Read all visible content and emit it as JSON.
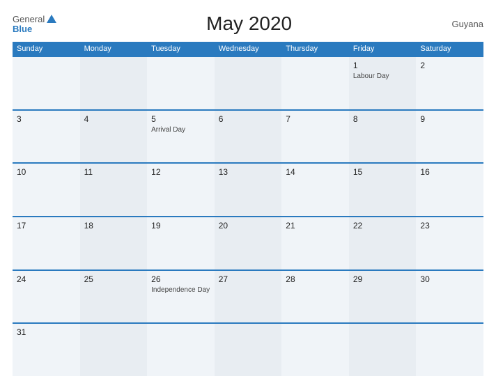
{
  "header": {
    "logo_general": "General",
    "logo_blue": "Blue",
    "title": "May 2020",
    "country": "Guyana"
  },
  "weekdays": [
    "Sunday",
    "Monday",
    "Tuesday",
    "Wednesday",
    "Thursday",
    "Friday",
    "Saturday"
  ],
  "weeks": [
    [
      {
        "day": "",
        "holiday": ""
      },
      {
        "day": "",
        "holiday": ""
      },
      {
        "day": "",
        "holiday": ""
      },
      {
        "day": "",
        "holiday": ""
      },
      {
        "day": "",
        "holiday": ""
      },
      {
        "day": "1",
        "holiday": "Labour Day"
      },
      {
        "day": "2",
        "holiday": ""
      }
    ],
    [
      {
        "day": "3",
        "holiday": ""
      },
      {
        "day": "4",
        "holiday": ""
      },
      {
        "day": "5",
        "holiday": "Arrival Day"
      },
      {
        "day": "6",
        "holiday": ""
      },
      {
        "day": "7",
        "holiday": ""
      },
      {
        "day": "8",
        "holiday": ""
      },
      {
        "day": "9",
        "holiday": ""
      }
    ],
    [
      {
        "day": "10",
        "holiday": ""
      },
      {
        "day": "11",
        "holiday": ""
      },
      {
        "day": "12",
        "holiday": ""
      },
      {
        "day": "13",
        "holiday": ""
      },
      {
        "day": "14",
        "holiday": ""
      },
      {
        "day": "15",
        "holiday": ""
      },
      {
        "day": "16",
        "holiday": ""
      }
    ],
    [
      {
        "day": "17",
        "holiday": ""
      },
      {
        "day": "18",
        "holiday": ""
      },
      {
        "day": "19",
        "holiday": ""
      },
      {
        "day": "20",
        "holiday": ""
      },
      {
        "day": "21",
        "holiday": ""
      },
      {
        "day": "22",
        "holiday": ""
      },
      {
        "day": "23",
        "holiday": ""
      }
    ],
    [
      {
        "day": "24",
        "holiday": ""
      },
      {
        "day": "25",
        "holiday": ""
      },
      {
        "day": "26",
        "holiday": "Independence Day"
      },
      {
        "day": "27",
        "holiday": ""
      },
      {
        "day": "28",
        "holiday": ""
      },
      {
        "day": "29",
        "holiday": ""
      },
      {
        "day": "30",
        "holiday": ""
      }
    ],
    [
      {
        "day": "31",
        "holiday": ""
      },
      {
        "day": "",
        "holiday": ""
      },
      {
        "day": "",
        "holiday": ""
      },
      {
        "day": "",
        "holiday": ""
      },
      {
        "day": "",
        "holiday": ""
      },
      {
        "day": "",
        "holiday": ""
      },
      {
        "day": "",
        "holiday": ""
      }
    ]
  ],
  "colors": {
    "accent": "#2a7abf",
    "cell_bg_1": "#f5f5f5",
    "cell_bg_2": "#ebebeb"
  }
}
